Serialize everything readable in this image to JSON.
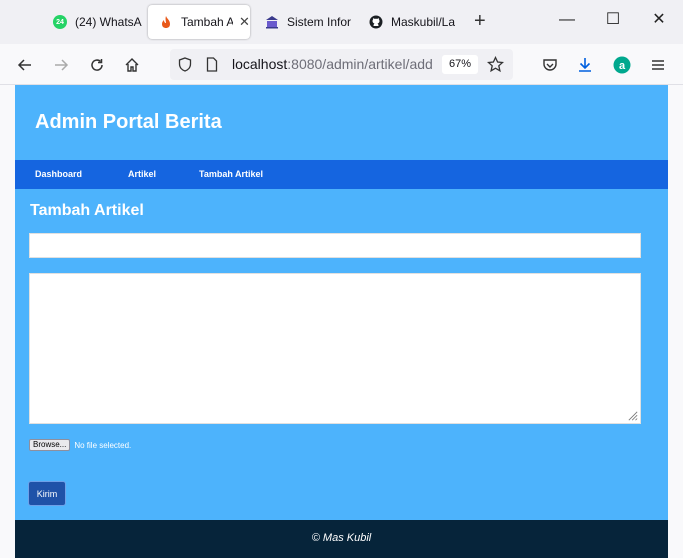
{
  "browser": {
    "tabs": [
      {
        "label": "(24) WhatsA",
        "badge": "24",
        "icon": "whatsapp-icon"
      },
      {
        "label": "Tambah A",
        "icon": "flame-icon",
        "active": true
      },
      {
        "label": "Sistem Infor",
        "icon": "university-icon"
      },
      {
        "label": "Maskubil/La",
        "icon": "github-icon"
      }
    ],
    "url_host": "localhost",
    "url_rest": ":8080/admin/artikel/add",
    "zoom": "67%"
  },
  "site": {
    "title": "Admin Portal Berita",
    "menu": [
      "Dashboard",
      "Artikel",
      "Tambah Artikel"
    ]
  },
  "form": {
    "heading": "Tambah Artikel",
    "title_value": "",
    "body_value": "",
    "browse_label": "Browse...",
    "file_status": "No file selected.",
    "submit_label": "Kirim"
  },
  "footer": {
    "text": "© Mas Kubil"
  },
  "colors": {
    "page_bg": "#4db3fc",
    "menu_bg": "#1565e0",
    "footer_bg": "#06243a",
    "button_bg": "#1f52a8"
  }
}
